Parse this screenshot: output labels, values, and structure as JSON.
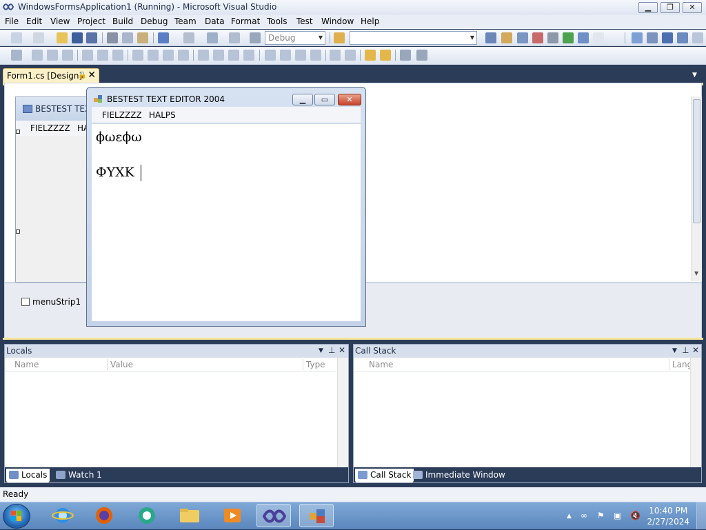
{
  "titlebar": {
    "title": "WindowsFormsApplication1 (Running) - Microsoft Visual Studio",
    "minimize": "▁",
    "restore": "❐",
    "close": "✕"
  },
  "menubar": {
    "items": [
      "File",
      "Edit",
      "View",
      "Project",
      "Build",
      "Debug",
      "Team",
      "Data",
      "Format",
      "Tools",
      "Test",
      "Window",
      "Help"
    ]
  },
  "toolbar": {
    "config_combo": "Debug",
    "platform_combo": ""
  },
  "document_tab": {
    "label": "Form1.cs [Design]",
    "close": "✕"
  },
  "designer": {
    "form_title": "BESTEST TEXT",
    "menu_1": "FIELZZZZ",
    "menu_2": "HA",
    "tray_item": "menuStrip1"
  },
  "app_window": {
    "title": "BESTEST TEXT EDITOR 2004",
    "menu": [
      "FIELZZZZ",
      "HALPS"
    ],
    "text_lines": [
      "ϕωεϕω",
      "ΦΥΧΚ"
    ]
  },
  "locals_pane": {
    "title": "Locals",
    "columns": [
      "Name",
      "Value",
      "Type"
    ],
    "tabs": [
      "Locals",
      "Watch 1"
    ]
  },
  "callstack_pane": {
    "title": "Call Stack",
    "columns": [
      "Name",
      "Lang"
    ],
    "tabs": [
      "Call Stack",
      "Immediate Window"
    ]
  },
  "statusbar": {
    "text": "Ready"
  },
  "taskbar": {
    "time": "10:40 PM",
    "date": "2/27/2024"
  },
  "colors": {
    "ide_background": "#2b3c59",
    "tab_active": "#fbf1c8",
    "close_button": "#c9432a"
  }
}
